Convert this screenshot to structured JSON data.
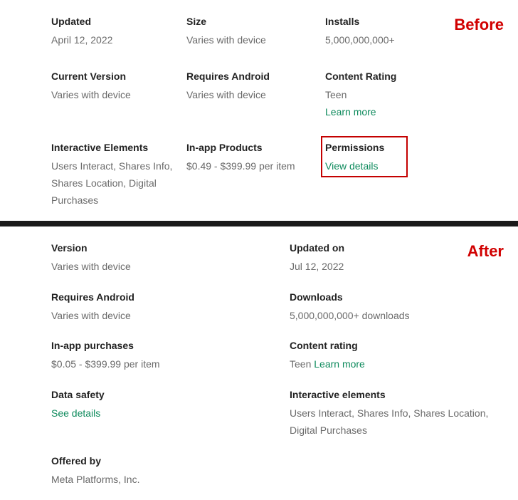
{
  "annotations": {
    "before": "Before",
    "after": "After"
  },
  "before": {
    "updated": {
      "label": "Updated",
      "value": "April 12, 2022"
    },
    "size": {
      "label": "Size",
      "value": "Varies with device"
    },
    "installs": {
      "label": "Installs",
      "value": "5,000,000,000+"
    },
    "currentVersion": {
      "label": "Current Version",
      "value": "Varies with device"
    },
    "requiresAndroid": {
      "label": "Requires Android",
      "value": "Varies with device"
    },
    "contentRating": {
      "label": "Content Rating",
      "value": "Teen",
      "link": "Learn more"
    },
    "interactiveElements": {
      "label": "Interactive Elements",
      "value": "Users Interact, Shares Info, Shares Location, Digital Purchases"
    },
    "inAppProducts": {
      "label": "In-app Products",
      "value": "$0.49 - $399.99 per item"
    },
    "permissions": {
      "label": "Permissions",
      "link": "View details"
    }
  },
  "after": {
    "version": {
      "label": "Version",
      "value": "Varies with device"
    },
    "updatedOn": {
      "label": "Updated on",
      "value": "Jul 12, 2022"
    },
    "requiresAndroid": {
      "label": "Requires Android",
      "value": "Varies with device"
    },
    "downloads": {
      "label": "Downloads",
      "value": "5,000,000,000+ downloads"
    },
    "inAppPurchases": {
      "label": "In-app purchases",
      "value": "$0.05 - $399.99 per item"
    },
    "contentRating": {
      "label": "Content rating",
      "value": "Teen ",
      "link": "Learn more"
    },
    "dataSafety": {
      "label": "Data safety",
      "link": "See details"
    },
    "interactiveElements": {
      "label": "Interactive elements",
      "value": "Users Interact, Shares Info, Shares Location, Digital Purchases"
    },
    "offeredBy": {
      "label": "Offered by",
      "value": "Meta Platforms, Inc."
    }
  }
}
